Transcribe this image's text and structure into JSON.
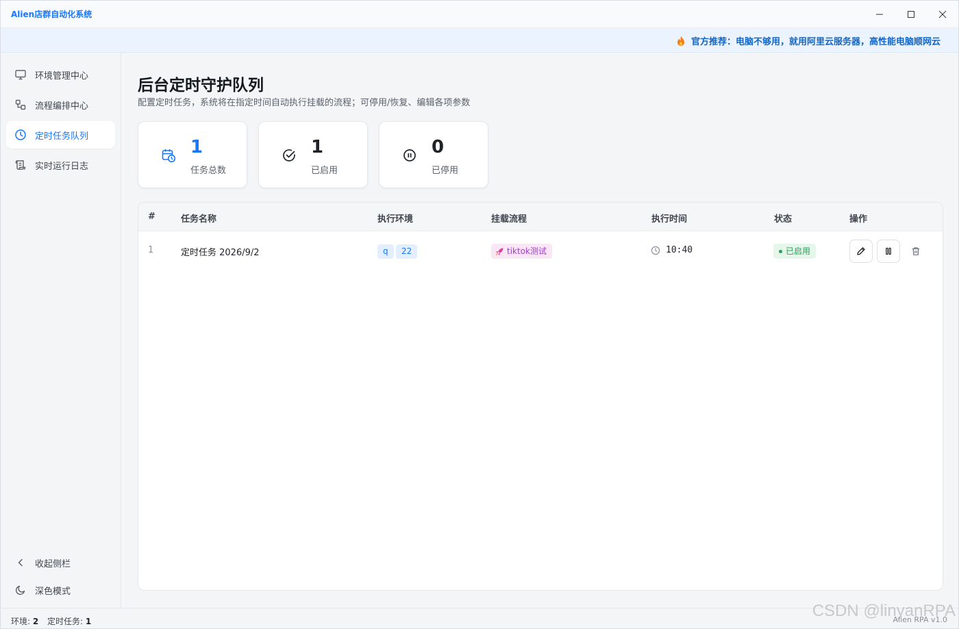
{
  "window": {
    "title": "Alien店群自动化系统"
  },
  "banner": {
    "text": "官方推荐：电脑不够用，就用阿里云服务器，高性能电脑顺网云"
  },
  "sidebar": {
    "items": [
      {
        "label": "环境管理中心",
        "icon": "monitor-icon",
        "active": false
      },
      {
        "label": "流程编排中心",
        "icon": "flow-icon",
        "active": false
      },
      {
        "label": "定时任务队列",
        "icon": "clock-icon",
        "active": true
      },
      {
        "label": "实时运行日志",
        "icon": "scroll-icon",
        "active": false
      }
    ],
    "collapse_label": "收起侧栏",
    "dark_mode_label": "深色模式"
  },
  "page": {
    "title": "后台定时守护队列",
    "description": "配置定时任务，系统将在指定时间自动执行挂载的流程；可停用/恢复、编辑各项参数"
  },
  "stats": [
    {
      "value": "1",
      "label": "任务总数",
      "icon": "calendar-clock-icon"
    },
    {
      "value": "1",
      "label": "已启用",
      "icon": "check-circle-icon"
    },
    {
      "value": "0",
      "label": "已停用",
      "icon": "pause-circle-icon"
    }
  ],
  "table": {
    "headers": [
      "#",
      "任务名称",
      "执行环境",
      "挂载流程",
      "执行时间",
      "状态",
      "操作"
    ],
    "rows": [
      {
        "index": "1",
        "name": "定时任务 2026/9/2",
        "envs": [
          "q",
          "22"
        ],
        "flow": "tiktok测试",
        "time": "10:40",
        "status": "已启用"
      }
    ]
  },
  "statusbar": {
    "env_label": "环境:",
    "env_count": "2",
    "task_label": "定时任务:",
    "task_count": "1",
    "version": "Alien RPA v1.0"
  },
  "watermark": "CSDN @linyanRPA",
  "colors": {
    "accent": "#1677ff",
    "success": "#22a454",
    "flow_tag": "#9b3fc7"
  }
}
